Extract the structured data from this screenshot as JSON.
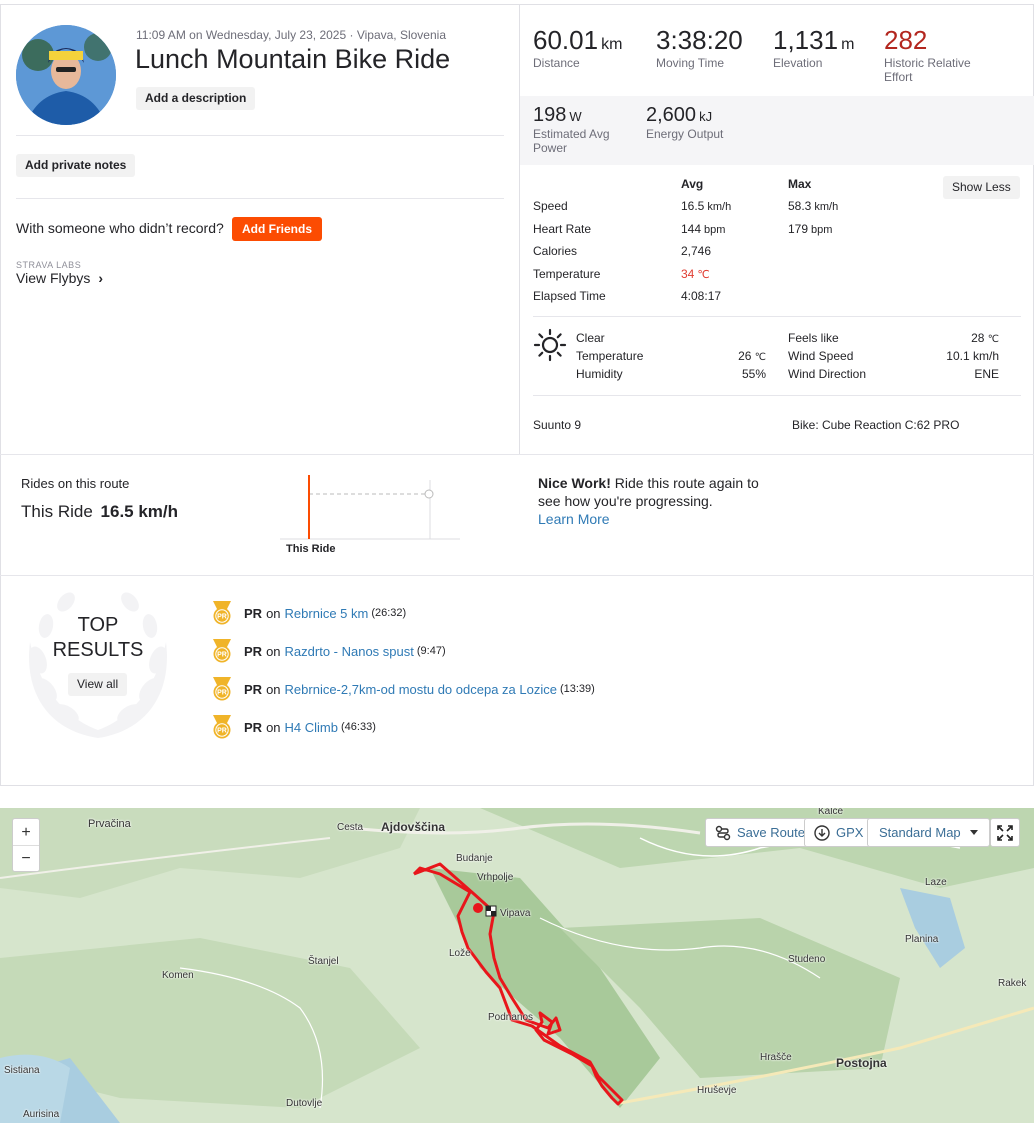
{
  "activity": {
    "datetime": "11:09 AM on Wednesday, July 23, 2025",
    "location": "Vipava, Slovenia",
    "title": "Lunch Mountain Bike Ride",
    "add_description": "Add a description",
    "add_private_notes": "Add private notes",
    "with_someone": "With someone who didn’t record?",
    "add_friends": "Add Friends",
    "labs_label": "STRAVA LABS",
    "view_flybys": "View Flybys",
    "chevron": "›"
  },
  "stats": {
    "distance": {
      "value": "60.01",
      "unit": "km",
      "label": "Distance"
    },
    "moving_time": {
      "value": "3:38:20",
      "label": "Moving Time"
    },
    "elevation": {
      "value": "1,131",
      "unit": "m",
      "label": "Elevation"
    },
    "relative_effort": {
      "value": "282",
      "label_1": "Historic Relative",
      "label_2": "Effort",
      "color": "#b3271f"
    },
    "power": {
      "value": "198",
      "unit": "W",
      "label_1": "Estimated Avg",
      "label_2": "Power"
    },
    "energy": {
      "value": "2,600",
      "unit": "kJ",
      "label": "Energy Output"
    }
  },
  "details": {
    "col_avg": "Avg",
    "col_max": "Max",
    "show_less": "Show Less",
    "rows": [
      {
        "label": "Speed",
        "avg": "16.5",
        "avg_unit": "km/h",
        "max": "58.3",
        "max_unit": "km/h"
      },
      {
        "label": "Heart Rate",
        "avg": "144",
        "avg_unit": "bpm",
        "max": "179",
        "max_unit": "bpm"
      },
      {
        "label": "Calories",
        "avg": "2,746",
        "avg_unit": "",
        "max": "",
        "max_unit": ""
      },
      {
        "label": "Temperature",
        "avg": "34",
        "avg_unit": "℃",
        "max": "",
        "max_unit": ""
      },
      {
        "label": "Elapsed Time",
        "avg": "4:08:17",
        "avg_unit": "",
        "max": "",
        "max_unit": ""
      }
    ],
    "temp_color": "#e03c31"
  },
  "weather": {
    "condition": "Clear",
    "temperature_label": "Temperature",
    "temperature_value": "26",
    "temperature_unit": "℃",
    "humidity_label": "Humidity",
    "humidity_value": "55%",
    "feels_like_label": "Feels like",
    "feels_like_value": "28",
    "feels_like_unit": "℃",
    "wind_speed_label": "Wind Speed",
    "wind_speed_value": "10.1 km/h",
    "wind_dir_label": "Wind Direction",
    "wind_dir_value": "ENE",
    "icon": "sun-icon"
  },
  "gear": {
    "device": "Suunto 9",
    "bike": "Bike: Cube Reaction C:62 PRO"
  },
  "route": {
    "heading": "Rides on this route",
    "this_ride_label": "This Ride",
    "this_ride_speed": "16.5 km/h",
    "axis_label": "This Ride",
    "nice_work_bold": "Nice Work!",
    "nice_work_text": " Ride this route again to see how you're progressing.",
    "learn_more": "Learn More"
  },
  "top_results": {
    "heading_1": "TOP",
    "heading_2": "RESULTS",
    "view_all": "View all",
    "items": [
      {
        "badge": "PR",
        "on": "on",
        "segment": "Rebrnice 5 km",
        "time": "(26:32)"
      },
      {
        "badge": "PR",
        "on": "on",
        "segment": "Razdrto - Nanos spust",
        "time": "(9:47)"
      },
      {
        "badge": "PR",
        "on": "on",
        "segment": "Rebrnice-2,7km-od mostu do odcepa za Lozice",
        "time": "(13:39)"
      },
      {
        "badge": "PR",
        "on": "on",
        "segment": "H4 Climb",
        "time": "(46:33)"
      }
    ],
    "medal_color": "#f0b429"
  },
  "map": {
    "zoom_in": "+",
    "zoom_out": "−",
    "save_route": "Save Route",
    "gpx": "GPX",
    "map_style": "Standard Map",
    "places": {
      "ajdovscina": "Ajdovščina",
      "prvacina": "Prvačina",
      "cesta": "Cesta",
      "budanje": "Budanje",
      "vrhpolje": "Vrhpolje",
      "vipava": "Vipava",
      "lozice": "Lože",
      "stanjel": "Štanjel",
      "komen": "Komen",
      "podnanos": "Podnanos",
      "sistiana": "Sistiana",
      "aurisina": "Aurisina",
      "dutovlje": "Dutovlje",
      "kalce": "Kalce",
      "laze": "Laze",
      "planina": "Planina",
      "studeno": "Studeno",
      "rakek": "Rakek",
      "hrasce": "Hrašče",
      "postojna": "Postojna",
      "hrusevje": "Hruševje"
    },
    "route_color": "#e8161b"
  }
}
